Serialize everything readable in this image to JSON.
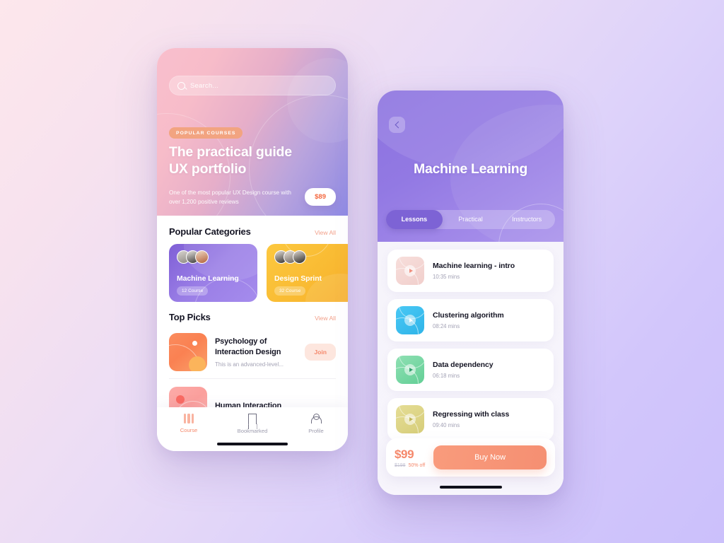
{
  "home": {
    "search": {
      "placeholder": "Search...",
      "icon": "search-icon"
    },
    "hero": {
      "tag": "POPULAR COURSES",
      "title_line1": "The practical guide",
      "title_line2": "UX portfolio",
      "subtitle": "One of the most popular UX Design course with over 1,200 positive reviews",
      "price": "$89"
    },
    "sections": [
      {
        "title": "Popular Categories",
        "action": "View All"
      },
      {
        "title": "Top Picks",
        "action": "View All"
      }
    ],
    "categories": [
      {
        "name": "Machine Learning",
        "badge": "12 Course",
        "color": "#9a7ee6"
      },
      {
        "name": "Design Sprint",
        "badge": "32 Course",
        "color": "#f9bb33"
      }
    ],
    "picks": [
      {
        "title": "Psychology of Interaction Design",
        "desc": "This is an advanced-level...",
        "action": "Join"
      },
      {
        "title": "Human Interaction",
        "desc": "",
        "action": ""
      }
    ],
    "tabbar": [
      {
        "label": "Course",
        "icon": "course-icon",
        "active": true
      },
      {
        "label": "Bookmarked",
        "icon": "bookmark-icon",
        "active": false
      },
      {
        "label": "Profile",
        "icon": "profile-icon",
        "active": false
      }
    ]
  },
  "course": {
    "back_icon": "chevron-left-icon",
    "title": "Machine Learning",
    "tabs": [
      {
        "label": "Lessons",
        "active": true
      },
      {
        "label": "Practical",
        "active": false
      },
      {
        "label": "Instructors",
        "active": false
      }
    ],
    "lessons": [
      {
        "title": "Machine learning - intro",
        "time": "10:35 mins",
        "color": "#f6d8d6"
      },
      {
        "title": "Clustering algorithm",
        "time": "08:24 mins",
        "color": "#3ec0f0"
      },
      {
        "title": "Data dependency",
        "time": "06:18 mins",
        "color": "#7ed9a8"
      },
      {
        "title": "Regressing with class",
        "time": "09:40 mins",
        "color": "#ddd58b"
      }
    ],
    "purchase": {
      "price": "$99",
      "old_price": "$198",
      "discount": "50% off",
      "buy_label": "Buy Now"
    }
  },
  "theme": {
    "accent_coral": "#f5886b",
    "accent_purple": "#8c72df",
    "accent_yellow": "#f9bb33"
  }
}
